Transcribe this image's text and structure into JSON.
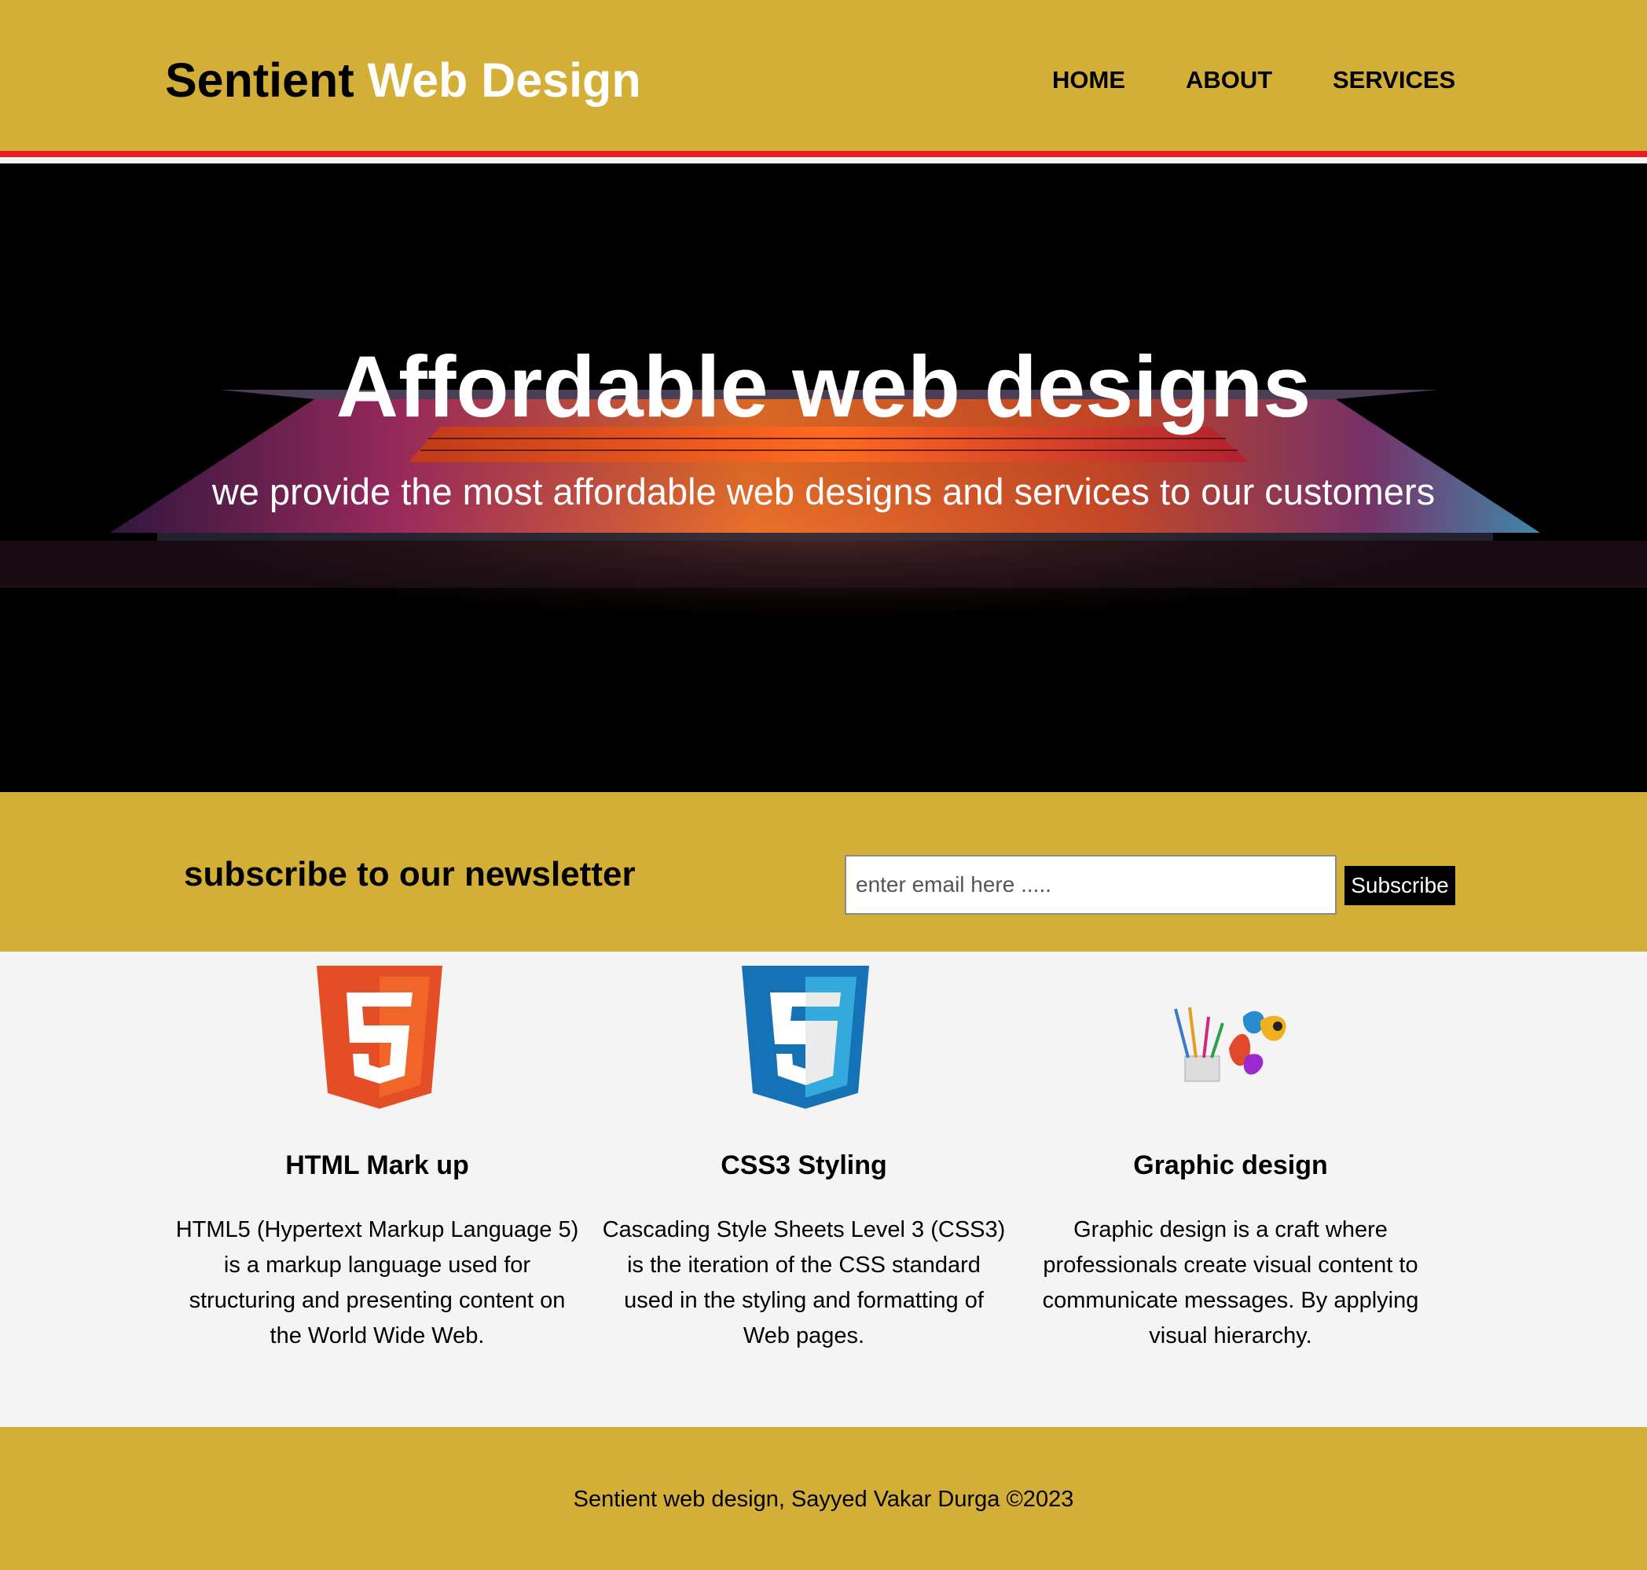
{
  "header": {
    "brand_part1": "Sentient",
    "brand_part2": "Web Design",
    "nav": [
      "HOME",
      "ABOUT",
      "SERVICES"
    ]
  },
  "hero": {
    "title": "Affordable web designs",
    "subtitle": "we provide the most affordable web designs and services to our customers"
  },
  "newsletter": {
    "heading": "subscribe to our newsletter",
    "email_placeholder": "enter email here .....",
    "email_value": "",
    "button_label": "Subscribe"
  },
  "features": [
    {
      "icon": "html5-logo-icon",
      "title": "HTML Mark up",
      "text": "HTML5 (Hypertext Markup Language 5) is a markup language used for structuring and presenting content on the World Wide Web."
    },
    {
      "icon": "css3-logo-icon",
      "title": "CSS3 Styling",
      "text": "Cascading Style Sheets Level 3 (CSS3) is the iteration of the CSS standard used in the styling and formatting of Web pages."
    },
    {
      "icon": "graphic-design-icon",
      "title": "Graphic design",
      "text": "Graphic design is a craft where professionals create visual content to communicate messages. By applying visual hierarchy."
    }
  ],
  "footer": {
    "text": "Sentient web design, Sayyed Vakar Durga ©2023"
  },
  "colors": {
    "brand_gold": "#d4af37",
    "accent_red": "#e51c23",
    "hero_bg": "#000000",
    "html5_orange": "#e44d26",
    "css3_blue": "#1572b6"
  }
}
